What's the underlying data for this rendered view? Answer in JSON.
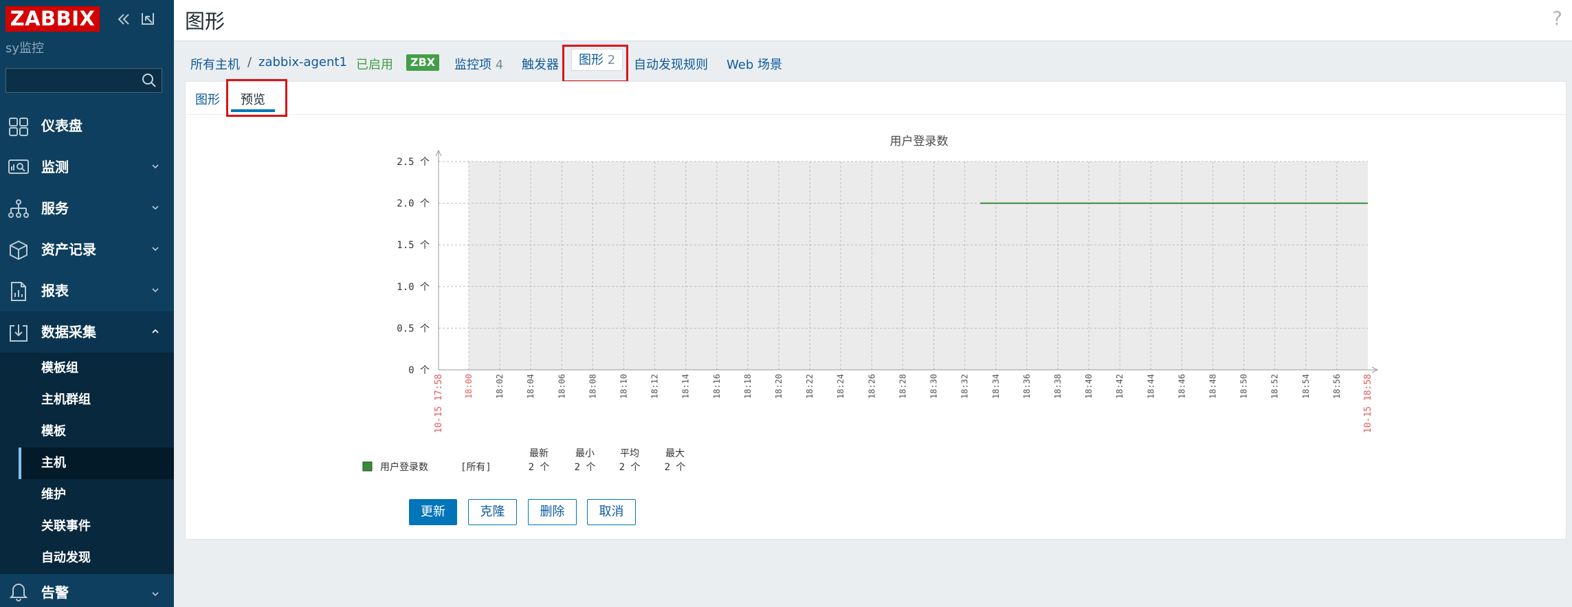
{
  "sidebar": {
    "logo": "ZABBIX",
    "server_name": "sy监控",
    "search_placeholder": "",
    "menu": [
      {
        "label": "仪表盘",
        "icon": "dashboard-icon"
      },
      {
        "label": "监测",
        "icon": "monitoring-icon"
      },
      {
        "label": "服务",
        "icon": "services-icon"
      },
      {
        "label": "资产记录",
        "icon": "inventory-icon"
      },
      {
        "label": "报表",
        "icon": "reports-icon"
      },
      {
        "label": "数据采集",
        "icon": "data-collection-icon"
      },
      {
        "label": "告警",
        "icon": "alerts-icon"
      }
    ],
    "submenu": [
      "模板组",
      "主机群组",
      "模板",
      "主机",
      "维护",
      "关联事件",
      "自动发现"
    ],
    "selected_submenu": "主机"
  },
  "header": {
    "title": "图形",
    "help": "?"
  },
  "breadcrumb": {
    "all_hosts": "所有主机",
    "separator": "/",
    "host": "zabbix-agent1",
    "enabled": "已启用",
    "zbx": "ZBX",
    "items_label": "监控项",
    "items_count": "4",
    "triggers_label": "触发器",
    "graphs_label": "图形",
    "graphs_count": "2",
    "discovery_label": "自动发现规则",
    "web_label": "Web 场景"
  },
  "tabs": {
    "graph": "图形",
    "preview": "预览"
  },
  "chart_data": {
    "type": "line",
    "title": "用户登录数",
    "ylim": [
      0,
      2.5
    ],
    "y_ticks": [
      "0 个",
      "0.5 个",
      "1.0 个",
      "1.5 个",
      "2.0 个",
      "2.5 个"
    ],
    "x_ticks": [
      "18:00",
      "18:02",
      "18:04",
      "18:06",
      "18:08",
      "18:10",
      "18:12",
      "18:14",
      "18:16",
      "18:18",
      "18:20",
      "18:22",
      "18:24",
      "18:26",
      "18:28",
      "18:30",
      "18:32",
      "18:34",
      "18:36",
      "18:38",
      "18:40",
      "18:42",
      "18:44",
      "18:46",
      "18:48",
      "18:50",
      "18:52",
      "18:54",
      "18:56"
    ],
    "x_start_label": "10-15 17:58",
    "x_end_label": "10-15 18:58",
    "series": [
      {
        "name": "用户登录数",
        "color": "#3a8a3c",
        "x": [
          "18:33",
          "18:58"
        ],
        "values": [
          2,
          2
        ]
      }
    ],
    "legend": {
      "headers": [
        "最新",
        "最小",
        "平均",
        "最大"
      ],
      "function": "[所有]",
      "values": [
        "2 个",
        "2 个",
        "2 个",
        "2 个"
      ]
    },
    "grid": true
  },
  "buttons": {
    "update": "更新",
    "clone": "克隆",
    "delete": "删除",
    "cancel": "取消"
  },
  "colors": {
    "sidebar": "#0e3f5e",
    "logo": "#d40000",
    "accent": "#0275b8",
    "highlight_box": "#d8141a"
  }
}
